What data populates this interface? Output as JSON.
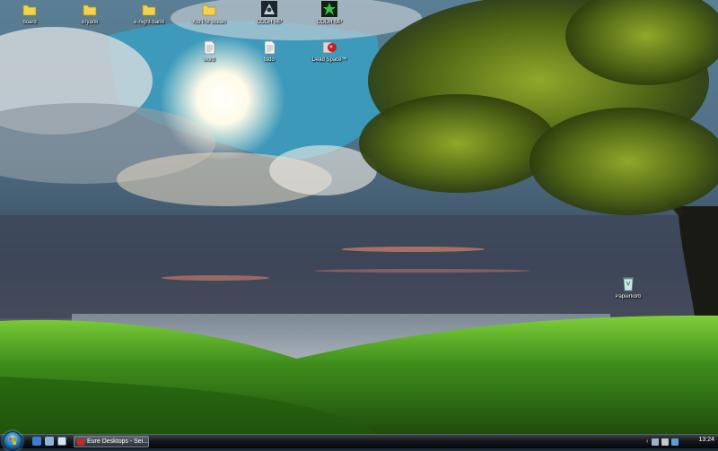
{
  "desktop": {
    "icons": [
      {
        "label": "board",
        "icon": "folder-icon"
      },
      {
        "label": "Bryan8",
        "icon": "folder-icon"
      },
      {
        "label": "e-night-band",
        "icon": "folder-icon"
      },
      {
        "label": "Kto Pie ocean",
        "icon": "folder-icon"
      },
      {
        "label": "CODH MP",
        "icon": "game-shortcut-icon"
      },
      {
        "label": "CODH MP",
        "icon": "game-shortcut-icon"
      },
      {
        "label": "word",
        "icon": "document-icon"
      },
      {
        "label": "todo",
        "icon": "document-icon"
      },
      {
        "label": "Dead Space™",
        "icon": "game-shortcut-icon"
      },
      {
        "label": "Papierkorb",
        "icon": "recycle-bin-icon"
      }
    ]
  },
  "taskbar": {
    "task_label": "Eure Desktops - Sei...",
    "clock": "13:24",
    "tray_arrow": "‹"
  },
  "colors": {
    "taskbar": "#0a0c0e",
    "sky": "#3d8aa8",
    "grass": "#4a8a1e",
    "folder": "#f2d34d"
  }
}
